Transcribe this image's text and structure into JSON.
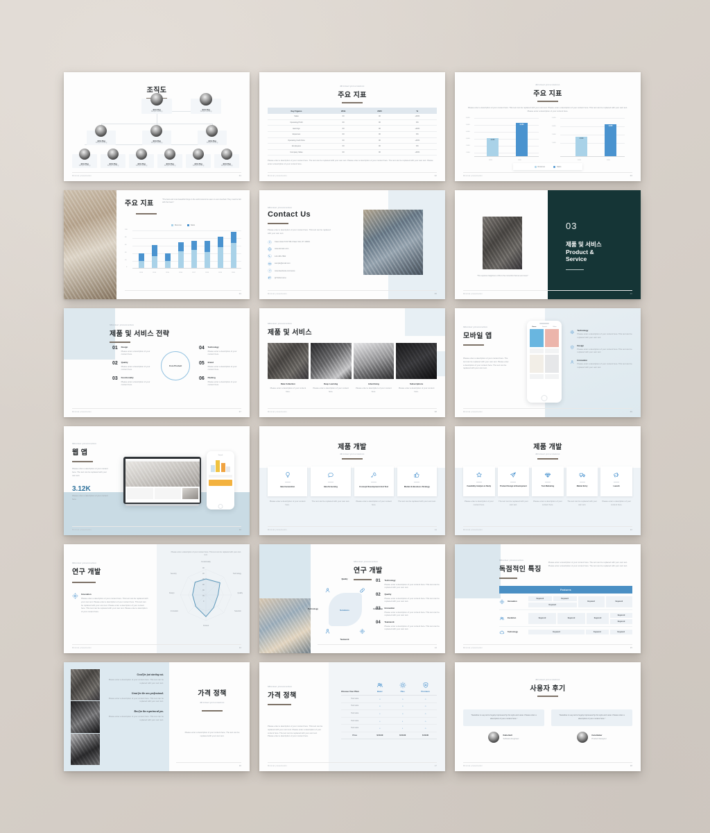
{
  "meta": {
    "footer_left": "Minimal presentation",
    "footer_right": "Presentation deck title",
    "eyebrow": "Minimal presentation"
  },
  "slides": [
    {
      "id": "org-chart",
      "page": "01",
      "title": "조직도",
      "nodes": [
        {
          "name": "John Doe",
          "role": "Sample wording"
        },
        {
          "name": "John Doe",
          "role": "Sample wording"
        },
        {
          "name": "John Doe",
          "role": "Sample wording"
        },
        {
          "name": "John Doe",
          "role": "Sample wording"
        },
        {
          "name": "John Doe",
          "role": "Sample wording"
        },
        {
          "name": "John Doe",
          "role": "Sample wording"
        },
        {
          "name": "John Doe",
          "role": "Sample wording"
        },
        {
          "name": "John Doe",
          "role": "Sample wording"
        },
        {
          "name": "John Doe",
          "role": "Sample wording"
        },
        {
          "name": "John Doe",
          "role": "Sample wording"
        },
        {
          "name": "John Doe",
          "role": "Sample wording"
        }
      ]
    },
    {
      "id": "key-metrics-table",
      "page": "02",
      "title": "주요 지표",
      "eyebrow": "Minimal presentation",
      "table": {
        "headers": [
          "Key Figures",
          "2019",
          "2020",
          "%"
        ],
        "rows": [
          [
            "Sales",
            "00",
            "00",
            "+00%"
          ],
          [
            "Operating Profit",
            "00",
            "00",
            "0%"
          ],
          [
            "Earnings",
            "00",
            "00",
            "+00%"
          ],
          [
            "Expenses",
            "00",
            "00",
            "0%"
          ],
          [
            "Operating Cash Flow",
            "00",
            "00",
            "+00%"
          ],
          [
            "Employees",
            "00",
            "00",
            "0%"
          ],
          [
            "Company Value",
            "00",
            "00",
            "+00%"
          ]
        ]
      },
      "note": "Please enter a description of your content here. The text can be replaced with your own text. Please enter a description of your content here. The text can be replaced with your own text. Please enter a description of your content here."
    },
    {
      "id": "key-metrics-bars",
      "page": "03",
      "title": "주요 지표",
      "eyebrow": "Minimal presentation",
      "note": "Please enter a description of your content here. This text can be replaced with your own text. Please enter a description of your content here. This text can be replaced with your own text. Please enter a description of your content here.",
      "legend": [
        "Revenue",
        "Sales"
      ]
    },
    {
      "id": "key-metrics-stacked",
      "page": "04",
      "title": "주요 지표",
      "quote": "\"The best and most beautiful things in the world cannot be seen or even touched. They must be felt with the heart.\"",
      "legend": [
        "Revenue",
        "Sales"
      ]
    },
    {
      "id": "contact-us",
      "page": "05",
      "eyebrow": "Minimal presentation",
      "title": "Contact Us",
      "note": "Please enter a description of your content here. This text can be replaced with your own text.",
      "items": [
        {
          "icon": "location-icon",
          "text": "Case street N W 700 A New York, NY 10001"
        },
        {
          "icon": "globe-icon",
          "text": "www.domain.com"
        },
        {
          "icon": "phone-icon",
          "text": "123-456-7890"
        },
        {
          "icon": "mail-icon",
          "text": "sample@email.com"
        },
        {
          "icon": "facebook-icon",
          "text": "www.facebook.com/name"
        },
        {
          "icon": "twitter-icon",
          "text": "@Twittername"
        }
      ]
    },
    {
      "id": "section-product-service",
      "page": "06",
      "number": "03",
      "title_ko": "제품 및 서비스",
      "title_en_1": "Product &",
      "title_en_2": "Service",
      "caption": "\"The supreme happiness of life is the conviction that we are loved.\""
    },
    {
      "id": "product-service-strategy",
      "page": "07",
      "eyebrow": "Minimal presentation",
      "title": "제품 및 서비스 전략",
      "center_label": "Core Product",
      "items": [
        {
          "num": "01",
          "head": "Design",
          "text": "Please enter a description of your content here."
        },
        {
          "num": "02",
          "head": "Quality",
          "text": "Please enter a description of your content here."
        },
        {
          "num": "03",
          "head": "Functionality",
          "text": "Please enter a description of your content here."
        },
        {
          "num": "04",
          "head": "Technology",
          "text": "Please enter a description of your content here."
        },
        {
          "num": "05",
          "head": "Brand",
          "text": "Please enter a description of your content here."
        },
        {
          "num": "06",
          "head": "Packing",
          "text": "Please enter a description of your content here."
        }
      ]
    },
    {
      "id": "product-service-grid",
      "page": "08",
      "eyebrow": "Minimal presentation",
      "title": "제품 및 서비스",
      "items": [
        {
          "head": "Data Collection",
          "text": "Please enter a description of your content here."
        },
        {
          "head": "Deep Learning",
          "text": "Please enter a description of your content here."
        },
        {
          "head": "Advertising",
          "text": "Please enter a description of your content here."
        },
        {
          "head": "Subscriptions",
          "text": "Please enter a description of your content here."
        }
      ]
    },
    {
      "id": "mobile-app",
      "page": "09",
      "eyebrow": "Minimal presentation",
      "title": "모바일 앱",
      "note": "Please enter a description of your content here. The text can be replaced with your own text. Please enter a description of your content here. The text can be replaced with your own text.",
      "items": [
        {
          "icon": "gear-icon",
          "head": "Technology",
          "text": "Please enter a description of your content here. This text can be replaced with your own text."
        },
        {
          "icon": "shield-icon",
          "head": "Design",
          "text": "Please enter a description of your content here. This text can be replaced with your own text."
        },
        {
          "icon": "user-icon",
          "head": "Innovation",
          "text": "Please enter a description of your content here. This text can be replaced with your own text."
        }
      ]
    },
    {
      "id": "web-app",
      "page": "10",
      "eyebrow": "Minimal presentation",
      "title": "웹 앱",
      "note": "Please enter a description of your content here. The text can be replaced with your own text.",
      "stat_value": "3.12K",
      "stat_text": "Please enter a description of your content here."
    },
    {
      "id": "product-development-4",
      "page": "11",
      "title": "제품 개발",
      "eyebrow": "Minimal presentation",
      "cards": [
        {
          "icon": "lightbulb-icon",
          "title": "Idea Generation",
          "text": "Please enter a description of your content here."
        },
        {
          "icon": "chat-icon",
          "title": "Idea Screening",
          "text": "The text can be replaced with your own text."
        },
        {
          "icon": "rocket-icon",
          "title": "Concept Development And Test",
          "text": "Please enter a description of your content here."
        },
        {
          "icon": "thumbsup-icon",
          "title": "Market & Business Strategy",
          "text": "The text can be replaced with your own text."
        }
      ]
    },
    {
      "id": "product-development-5",
      "page": "12",
      "title": "제품 개발",
      "eyebrow": "Minimal presentation",
      "cards": [
        {
          "icon": "star-icon",
          "title": "Feasibility Analysis & Study",
          "text": "Please enter a description of your content here."
        },
        {
          "icon": "paperplane-icon",
          "title": "Product Design & Development",
          "text": "The text can be replaced with your own text."
        },
        {
          "icon": "diamond-icon",
          "title": "Test Marketing",
          "text": "Please enter a description of your content here."
        },
        {
          "icon": "truck-icon",
          "title": "Market Entry",
          "text": "The text can be replaced with your own text."
        },
        {
          "icon": "megaphone-icon",
          "title": "Launch",
          "text": "Please enter a description of your content here."
        }
      ]
    },
    {
      "id": "rnd-radar",
      "page": "13",
      "eyebrow": "Minimal presentation",
      "title": "연구 개발",
      "item_head": "Innovation",
      "item_text": "Please enter a description of your content here. This text can be replaced with your own text. Please enter a description of your content here. This text can be replaced with your own text. Please enter a description of your content here. This text can be replaced with your own text. Please enter a description of your content here.",
      "chart_note": "Please enter a description of your content here. This text can be replaced with your own text.",
      "radar_labels": [
        "Functionality",
        "Technology",
        "Quality",
        "Selection",
        "Content",
        "Innovation",
        "Design",
        "Security"
      ],
      "radar_ticks": [
        "00",
        "00",
        "00",
        "00",
        "00",
        "00",
        "0"
      ]
    },
    {
      "id": "rnd-solutions",
      "page": "14",
      "eyebrow": "Minimal presentation",
      "title": "연구 개발",
      "center_label": "Solutions",
      "diagram_labels": [
        "Quality",
        "Technology",
        "Innovation",
        "Teamwork"
      ],
      "items": [
        {
          "num": "01",
          "head": "Technology",
          "text": "Please enter a description of your content here. This text can be replaced with your own text."
        },
        {
          "num": "02",
          "head": "Quality",
          "text": "Please enter a description of your content here. This text can be replaced with your own text."
        },
        {
          "num": "03",
          "head": "Innovation",
          "text": "Please enter a description of your content here. This text can be replaced with your own text."
        },
        {
          "num": "04",
          "head": "Teamwork",
          "text": "Please enter a description of your content here. This text can be replaced with your own text."
        }
      ]
    },
    {
      "id": "exclusive-features",
      "page": "15",
      "eyebrow": "Minimal presentation",
      "title": "독점적인 특징",
      "note": "Please enter a description of your content here. The text can be replaced with your own text. Please enter a description of your content here. The text can be replaced with your own text.",
      "table_header": "Features",
      "rows": [
        {
          "icon": "gear-icon",
          "label": "Innovation",
          "cells": [
            "Keyword",
            "Keyword",
            "Keyword",
            "Keyword"
          ],
          "extra": "Keyword"
        },
        {
          "icon": "users-icon",
          "label": "Evolution",
          "cells": [
            "Keyword",
            "Keyword",
            "Keyword",
            "Keyword"
          ],
          "extra": "Keyword"
        },
        {
          "icon": "cloud-icon",
          "label": "Technology",
          "cells": [
            "Keyword",
            "Keyword",
            "Keyword"
          ],
          "extra": ""
        }
      ]
    },
    {
      "id": "pricing-intro",
      "page": "16",
      "title": "가격 정책",
      "eyebrow": "Minimal presentation",
      "note": "Please enter a description of your content here. The text can be replaced with your own text.",
      "tiers": [
        {
          "head": "Good for just starting out.",
          "text": "Please enter a description of your content here. This text can be replaced with your own text."
        },
        {
          "head": "Great for the new professional.",
          "text": "Please enter a description of your content here. This text can be replaced with your own text."
        },
        {
          "head": "Best for the experienced pro.",
          "text": "Please enter a description of your content here. This text can be replaced with your own text."
        }
      ]
    },
    {
      "id": "pricing-table",
      "page": "17",
      "eyebrow": "Minimal presentation",
      "title": "가격 정책",
      "note": "Please enter a description of your content here. This text can be replaced with your own text. Please enter a description of your content here. The text can be replaced with your own text. Please enter a description of your content here.",
      "choose_label": "Choose Your Plan",
      "plans": [
        {
          "icon": "users-icon",
          "name": "Basic"
        },
        {
          "icon": "sun-icon",
          "name": "Plus"
        },
        {
          "icon": "shield-icon",
          "name": "Premium"
        }
      ],
      "feature_rows": [
        {
          "label": "Text Here",
          "marks": [
            "o",
            "o",
            "o"
          ]
        },
        {
          "label": "Text Here",
          "marks": [
            "o",
            "o",
            "o"
          ]
        },
        {
          "label": "Text Here",
          "marks": [
            "•",
            "o",
            "o"
          ]
        },
        {
          "label": "Text Here",
          "marks": [
            "•",
            "•",
            "o"
          ]
        },
        {
          "label": "Text Here",
          "marks": [
            "•",
            "•",
            "o"
          ]
        }
      ],
      "price_label": "Price",
      "prices": [
        "$ 00.00",
        "$ 00.00",
        "$ 00.00"
      ]
    },
    {
      "id": "testimonials",
      "page": "18",
      "eyebrow": "Minimal presentation",
      "title": "사용자 후기",
      "cards": [
        {
          "quote": "\"Needless to say we're hugely impressed by the style and value. Please enter a description of your content here.\"",
          "name": "Katie Bell",
          "role": "Software Engineer"
        },
        {
          "quote": "\"Needless to say we're hugely impressed by the style and value. Please enter a description of your content here.\"",
          "name": "Cara Baker",
          "role": "Product Designer"
        }
      ]
    }
  ],
  "chart_data": [
    {
      "type": "bar",
      "title": "주요 지표 — Revenue",
      "categories": [
        "2019",
        "2020"
      ],
      "values": [
        3000,
        6000
      ],
      "ylabel": "",
      "ytick_labels": [
        "6,000",
        "5,000",
        "4,000",
        "3,000",
        "2,000",
        "1,000"
      ],
      "ylim": [
        0,
        6500
      ],
      "bar_labels": [
        "3,000",
        "6,000"
      ],
      "colors": [
        "#a9d2e8",
        "#4a93cf"
      ],
      "grid": true,
      "legend": [
        "Revenue",
        "Sales"
      ],
      "legend_position": "bottom"
    },
    {
      "type": "bar",
      "title": "주요 지표 — Sales",
      "categories": [
        "2019",
        "2020"
      ],
      "values": [
        2500,
        4000
      ],
      "ytick_labels": [
        "4,000",
        "3,000",
        "2,000",
        "1,000"
      ],
      "ylim": [
        0,
        4400
      ],
      "bar_labels": [
        "2,500",
        "4,000"
      ],
      "colors": [
        "#a9d2e8",
        "#4a93cf"
      ],
      "grid": true,
      "legend": [
        "Revenue",
        "Sales"
      ],
      "legend_position": "bottom"
    },
    {
      "type": "bar",
      "title": "주요 지표 — stacked by year",
      "categories": [
        "2013",
        "2014",
        "2015",
        "2016",
        "2017",
        "2018",
        "2019",
        "2020"
      ],
      "series": [
        {
          "name": "Revenue",
          "values": [
            18,
            32,
            18,
            44,
            48,
            46,
            58,
            70
          ]
        },
        {
          "name": "Sales",
          "values": [
            22,
            30,
            20,
            24,
            24,
            30,
            28,
            30
          ]
        }
      ],
      "ytick_labels": [
        "100",
        "80",
        "60",
        "40",
        "20",
        "0"
      ],
      "ylim": [
        0,
        100
      ],
      "colors": [
        "#a9d2e8",
        "#4a93cf"
      ],
      "grid": true,
      "legend": [
        "Revenue",
        "Sales"
      ],
      "legend_position": "top"
    },
    {
      "type": "radar",
      "title": "연구 개발 radar",
      "categories": [
        "Functionality",
        "Technology",
        "Quality",
        "Selection",
        "Content",
        "Innovation",
        "Design",
        "Security"
      ],
      "values": [
        62,
        78,
        70,
        54,
        88,
        46,
        56,
        60
      ],
      "ylim": [
        0,
        100
      ],
      "grid": true,
      "legend": []
    }
  ]
}
